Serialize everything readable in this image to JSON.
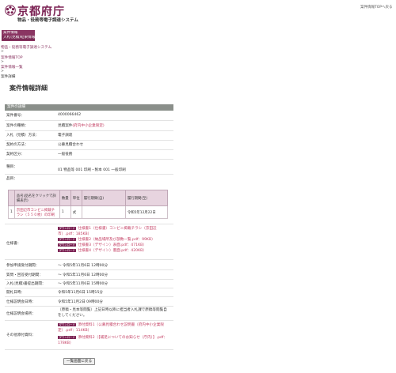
{
  "header": {
    "site_name": "京都府庁",
    "system_name": "物品・役務等電子調達システム",
    "top_link": "案件情報TOPへ戻る"
  },
  "sidebar": {
    "items": [
      {
        "label": "案件情報"
      },
      {
        "label": "入札(見積)結果情報"
      }
    ]
  },
  "breadcrumb": {
    "items": [
      {
        "label": "物品・役務等電子調達システム"
      },
      {
        "label": "案件情報TOP"
      },
      {
        "label": "案件情報一覧"
      }
    ],
    "separator": ">",
    "current": "案件詳細"
  },
  "page": {
    "title": "案件情報詳細"
  },
  "details": {
    "section_title": "案件の詳細",
    "rows": [
      {
        "label": "案件番号：",
        "value": "4000066462"
      },
      {
        "label": "案件の種類：",
        "value": "見積案件",
        "value_link": "(府内中小企業限定)"
      },
      {
        "label": "入札（見積）方法：",
        "value": "電子調達"
      },
      {
        "label": "契約の方法：",
        "value": "公募見積合わせ"
      },
      {
        "label": "契約区分：",
        "value": "一般役務"
      },
      {
        "label": "種目：",
        "value": "01 物品等 001 印刷・製本 001 一般印刷"
      },
      {
        "label": "品目：",
        "value": ""
      }
    ]
  },
  "items_table": {
    "headers": [
      "",
      "品名(品名をクリックで詳細表示)",
      "数量",
      "単位",
      "履行期間(自)",
      "履行期間(至)"
    ],
    "rows": [
      [
        "1",
        "京田辺市コンビニ掲載チラシ（５５０枚）の印刷",
        "1",
        "式",
        "",
        "令和5年12月22日"
      ]
    ]
  },
  "specs": {
    "label": "仕様書：",
    "badge": "ダウンロード",
    "files": [
      {
        "text": "仕様書1（仕様書）コンビニ掲載チラシ（京田辺市）.pdf：185KB）"
      },
      {
        "text": "仕様書2（納品場所及び部数一覧.pdf：99KB）"
      },
      {
        "text": "仕様書3（デザイン）表面.pdf：471KB）"
      },
      {
        "text": "仕様書4（デザイン）裏面.pdf：420KB）"
      }
    ]
  },
  "schedule": [
    {
      "label": "参加申請受付期間：",
      "value": "～ 令和5年11月6日 12時00分"
    },
    {
      "label": "質問・回答受付期間：",
      "value": "～ 令和5年11月6日 12時00分"
    },
    {
      "label": "入札(見積)書提出期間：",
      "value": "～ 令和5年11月6日 15時00分"
    },
    {
      "label": "開札日時：",
      "value": "令和5年11月6日 15時15分"
    },
    {
      "label": "仕様説明会日時：",
      "value": "令和5年11月2日 09時00分"
    },
    {
      "label": "仕様説明会場所：",
      "value_lines": [
        "（原稿・見本等閲覧）上記日時以降に担当者入札課で原稿等閲覧自",
        "をしてください。"
      ]
    }
  ],
  "other": {
    "label": "その他添付資料：",
    "badge": "ダウンロード",
    "files": [
      {
        "lines": [
          "添付資料1（公募見積合わせ説明書（府内中小企業限",
          "定）.pdf：114KB）"
        ]
      },
      {
        "lines": [
          "添付資料2（【補足についてのお知らせ（庁内）】.pdf：",
          "178KB）"
        ]
      }
    ]
  },
  "actions": {
    "back_label": "一覧画面に戻る"
  },
  "colors": {
    "brand": "#7b2253",
    "link": "#c23a5f",
    "nav_bg": "#8a3562",
    "section_head": "#8a8f8a",
    "table_head": "#e7d4df"
  }
}
